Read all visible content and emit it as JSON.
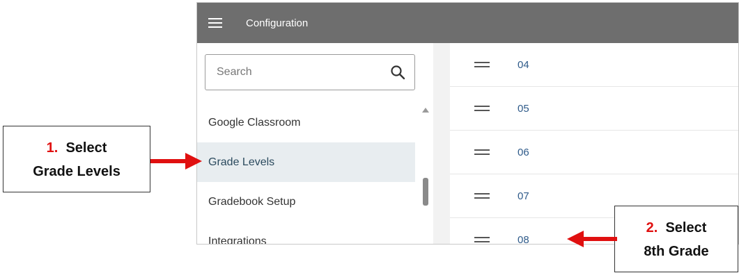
{
  "header": {
    "title": "Configuration",
    "menu_icon": "hamburger-menu-icon"
  },
  "search": {
    "placeholder": "Search",
    "icon": "search-icon"
  },
  "sidebar": {
    "items": [
      {
        "label": "Google Classroom",
        "active": false
      },
      {
        "label": "Grade Levels",
        "active": true
      },
      {
        "label": "Gradebook Setup",
        "active": false
      },
      {
        "label": "Integrations",
        "active": false
      }
    ]
  },
  "grades": {
    "rows": [
      "04",
      "05",
      "06",
      "07",
      "08"
    ]
  },
  "annotations": {
    "callout_1": {
      "number": "1.",
      "line1": "Select",
      "line2": "Grade Levels"
    },
    "callout_2": {
      "number": "2.",
      "line1": "Select",
      "line2": "8th Grade"
    }
  },
  "colors": {
    "topbar": "#6e6e6e",
    "active_item_bg": "#e8edf0",
    "link": "#2f5b8a",
    "arrow": "#e01010"
  }
}
